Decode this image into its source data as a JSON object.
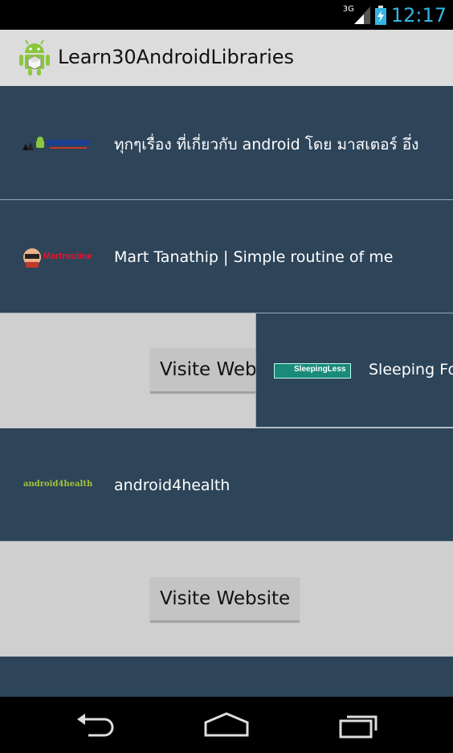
{
  "status_bar": {
    "time": "12:17",
    "network": "3G"
  },
  "action_bar": {
    "title": "Learn30AndroidLibraries",
    "icon": "android-robot-icon"
  },
  "list": {
    "rows": [
      {
        "label": "ทุกๆเรื่อง ที่เกี่ยวกับ android โดย มาสเตอร์ อึ่ง",
        "logo": "android-logo"
      },
      {
        "label": "Mart Tanathip | Simple routine of me",
        "logo": "Martroutine"
      },
      {
        "label": "Sleeping Fo",
        "logo": "SleepingLess",
        "button_label": "Visite Web"
      },
      {
        "label": "android4health",
        "logo": "android4health"
      }
    ],
    "expanded_button_label": "Visite Website"
  },
  "nav_bar": {
    "back": "back-icon",
    "home": "home-icon",
    "recents": "recents-icon"
  },
  "colors": {
    "row_bg": "#2d4459",
    "clock": "#33b5e5",
    "action_bar": "#dcdcdc"
  }
}
